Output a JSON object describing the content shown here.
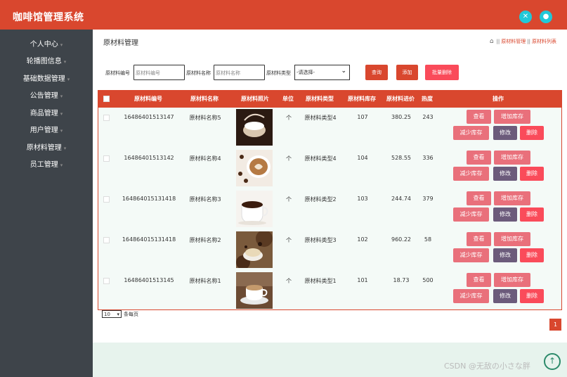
{
  "app": {
    "title": "咖啡馆管理系统"
  },
  "header": {
    "icons": [
      "tools-icon",
      "user-icon"
    ]
  },
  "sidebar": {
    "items": [
      {
        "label": "个人中心"
      },
      {
        "label": "轮播图信息"
      },
      {
        "label": "基础数据管理"
      },
      {
        "label": "公告管理"
      },
      {
        "label": "商品管理"
      },
      {
        "label": "用户管理"
      },
      {
        "label": "原材料管理"
      },
      {
        "label": "员工管理"
      }
    ]
  },
  "page": {
    "title": "原材料管理"
  },
  "breadcrumb": {
    "items": [
      "原材料管理",
      "原材料列表"
    ]
  },
  "search": {
    "fields": [
      {
        "label": "原材料编号",
        "placeholder": "原材料编号"
      },
      {
        "label": "原材料名称",
        "placeholder": "原材料名称"
      }
    ],
    "type_label": "原材料类型",
    "type_value": "-请选择-",
    "query_label": "查询",
    "add_label": "添加",
    "batch_delete_label": "批量删除"
  },
  "table": {
    "headers": [
      "原材料编号",
      "原材料名称",
      "原材料照片",
      "单位",
      "原材料类型",
      "原材料库存",
      "原材料进价",
      "热度",
      "操作"
    ],
    "rows": [
      {
        "code": "16486401513147",
        "name": "原材料名称5",
        "unit": "个",
        "type": "原材料类型4",
        "stock": "107",
        "price": "380.25",
        "heat": "243"
      },
      {
        "code": "16486401513142",
        "name": "原材料名称4",
        "unit": "个",
        "type": "原材料类型4",
        "stock": "104",
        "price": "528.55",
        "heat": "336"
      },
      {
        "code": "164864015131418",
        "name": "原材料名称3",
        "unit": "个",
        "type": "原材料类型2",
        "stock": "103",
        "price": "244.74",
        "heat": "379"
      },
      {
        "code": "164864015131418",
        "name": "原材料名称2",
        "unit": "个",
        "type": "原材料类型3",
        "stock": "102",
        "price": "960.22",
        "heat": "58"
      },
      {
        "code": "16486401513145",
        "name": "原材料名称1",
        "unit": "个",
        "type": "原材料类型1",
        "stock": "101",
        "price": "18.73",
        "heat": "500"
      }
    ],
    "actions": {
      "view": "查看",
      "add_stock": "增加库存",
      "reduce_stock": "减少库存",
      "edit": "修改",
      "delete": "删除"
    }
  },
  "pagination": {
    "per_page_value": "10",
    "per_page_label": "条每页",
    "current_page": "1"
  },
  "watermark": "CSDN @无敌の小さな胖",
  "colors": {
    "primary": "#d9472e",
    "view": "#e9707b",
    "edit": "#6c5b7b",
    "delete": "#fa4b5a",
    "sidebar": "#3e444a",
    "accent": "#21c8d8"
  }
}
